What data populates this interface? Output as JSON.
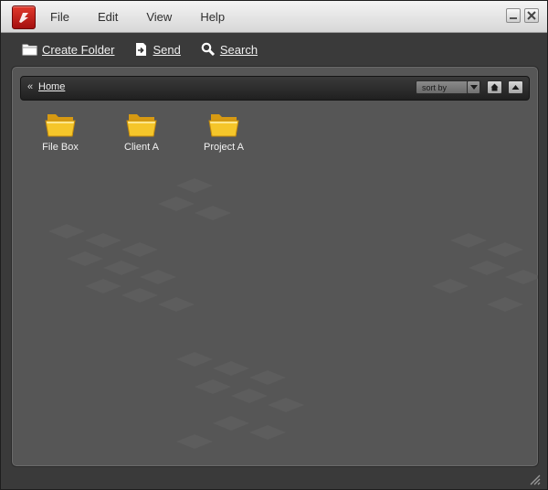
{
  "menu": {
    "items": [
      "File",
      "Edit",
      "View",
      "Help"
    ]
  },
  "toolbar": {
    "create_folder": "Create Folder",
    "send": "Send",
    "search": "Search"
  },
  "navbar": {
    "chevron": "«",
    "home_link": "Home",
    "sort_by": "sort by"
  },
  "folders": [
    {
      "name": "File Box"
    },
    {
      "name": "Client A"
    },
    {
      "name": "Project A"
    }
  ],
  "colors": {
    "folder_yellow": "#f5c62a",
    "panel_bg": "#565656",
    "frame_bg": "#3a3a3a",
    "app_red": "#c8231b"
  },
  "icons": {
    "app": "app-logo-icon",
    "create_folder": "folder-outline-icon",
    "send": "send-document-icon",
    "search": "magnifier-icon",
    "home": "home-icon",
    "up": "up-arrow-icon",
    "folder": "folder-icon",
    "resize": "resize-grip-icon"
  }
}
